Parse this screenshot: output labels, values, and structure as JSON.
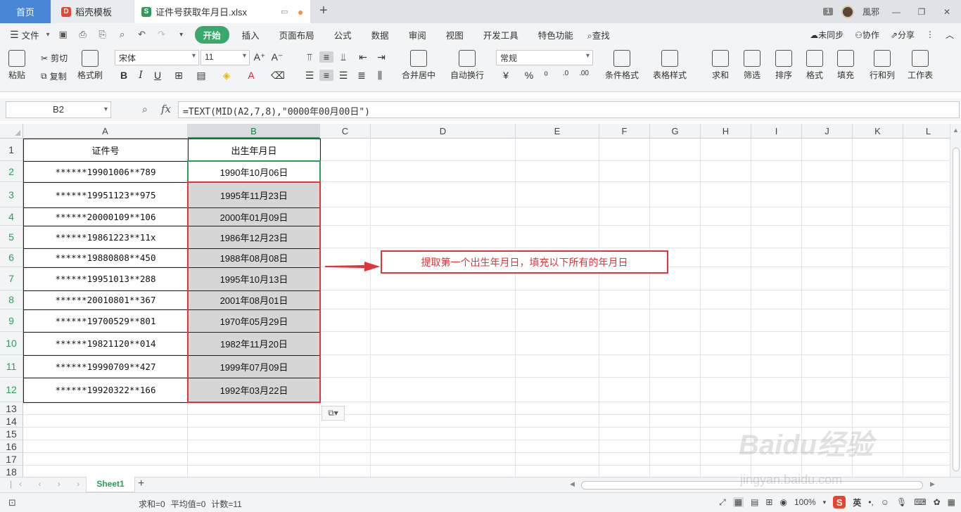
{
  "tabs": {
    "home": "首页",
    "template": "稻壳模板",
    "file": "证件号获取年月日.xlsx"
  },
  "user": {
    "badge": "1",
    "name": "風邪"
  },
  "menu": {
    "file": "文件",
    "items": [
      "开始",
      "插入",
      "页面布局",
      "公式",
      "数据",
      "审阅",
      "视图",
      "开发工具",
      "特色功能"
    ],
    "search": "查找",
    "sync": "未同步",
    "collab": "协作",
    "share": "分享"
  },
  "ribbon": {
    "paste": "粘贴",
    "cut": "剪切",
    "copy": "复制",
    "format_painter": "格式刷",
    "font_name": "宋体",
    "font_size": "11",
    "merge": "合并居中",
    "wrap": "自动换行",
    "number_format": "常规",
    "cond_format": "条件格式",
    "table_style": "表格样式",
    "sum": "求和",
    "filter": "筛选",
    "sort": "排序",
    "format": "格式",
    "fill": "填充",
    "rowcol": "行和列",
    "worksheet": "工作表"
  },
  "formula_bar": {
    "cell_ref": "B2",
    "formula": "=TEXT(MID(A2,7,8),\"0000年00月00日\")"
  },
  "sheet": {
    "columns": [
      "A",
      "B",
      "C",
      "D",
      "E",
      "F",
      "G",
      "H",
      "I",
      "J",
      "K",
      "L"
    ],
    "rows": [
      "1",
      "2",
      "3",
      "4",
      "5",
      "6",
      "7",
      "8",
      "9",
      "10",
      "11",
      "12",
      "13",
      "14",
      "15",
      "16",
      "17",
      "18"
    ],
    "header": {
      "a": "证件号",
      "b": "出生年月日"
    },
    "data": [
      {
        "id": "******19901006**789",
        "dob": "1990年10月06日"
      },
      {
        "id": "******19951123**975",
        "dob": "1995年11月23日"
      },
      {
        "id": "******20000109**106",
        "dob": "2000年01月09日"
      },
      {
        "id": "******19861223**11x",
        "dob": "1986年12月23日"
      },
      {
        "id": "******19880808**450",
        "dob": "1988年08月08日"
      },
      {
        "id": "******19951013**288",
        "dob": "1995年10月13日"
      },
      {
        "id": "******20010801**367",
        "dob": "2001年08月01日"
      },
      {
        "id": "******19700529**801",
        "dob": "1970年05月29日"
      },
      {
        "id": "******19821120**014",
        "dob": "1982年11月20日"
      },
      {
        "id": "******19990709**427",
        "dob": "1999年07月09日"
      },
      {
        "id": "******19920322**166",
        "dob": "1992年03月22日"
      }
    ],
    "annotation": "提取第一个出生年月日，填充以下所有的年月日"
  },
  "sheet_tab": "Sheet1",
  "status": {
    "sum": "求和=0",
    "avg": "平均值=0",
    "count": "计数=11",
    "zoom": "100%",
    "ime": "英"
  },
  "colors": {
    "accent": "#2e9b5a",
    "annotation": "#e0363a",
    "home_tab": "#4a86d8"
  },
  "watermark": {
    "logo": "Baidu经验",
    "url": "jingyan.baidu.com"
  }
}
